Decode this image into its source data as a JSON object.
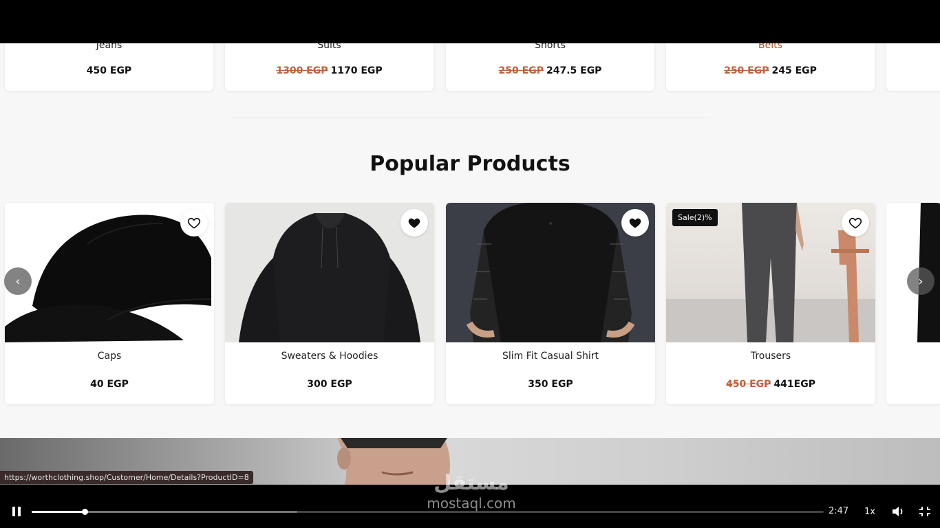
{
  "top_row": [
    {
      "name": "Jeans",
      "old_price": "",
      "price": "450 EGP",
      "name_accent": false
    },
    {
      "name": "Suits",
      "old_price": "1300 EGP",
      "price": "1170 EGP",
      "name_accent": false
    },
    {
      "name": "Shorts",
      "old_price": "250 EGP",
      "price": "247.5 EGP",
      "name_accent": false
    },
    {
      "name": "Belts",
      "old_price": "250 EGP",
      "price": "245 EGP",
      "name_accent": true
    }
  ],
  "section_title": "Popular Products",
  "products": [
    {
      "title": "Caps",
      "old_price": "",
      "price": "40 EGP",
      "favorited": false,
      "badge": ""
    },
    {
      "title": "Sweaters & Hoodies",
      "old_price": "",
      "price": "300 EGP",
      "favorited": true,
      "badge": ""
    },
    {
      "title": "Slim Fit Casual Shirt",
      "old_price": "",
      "price": "350 EGP",
      "favorited": true,
      "badge": ""
    },
    {
      "title": "Trousers",
      "old_price": "450 EGP",
      "price": "441EGP",
      "favorited": false,
      "badge": "Sale(2)%"
    }
  ],
  "status_url": "https://worthclothing.shop/Customer/Home/Details?ProductID=8",
  "player": {
    "time": "2:47",
    "speed": "1x",
    "played_fraction": 0.067,
    "buffered_fraction": 0.335
  },
  "watermark": {
    "arabic": "مستقل",
    "latin": "mostaql.com"
  },
  "colors": {
    "accent_price": "#c0603c",
    "page_bg": "#f7f7f7"
  }
}
